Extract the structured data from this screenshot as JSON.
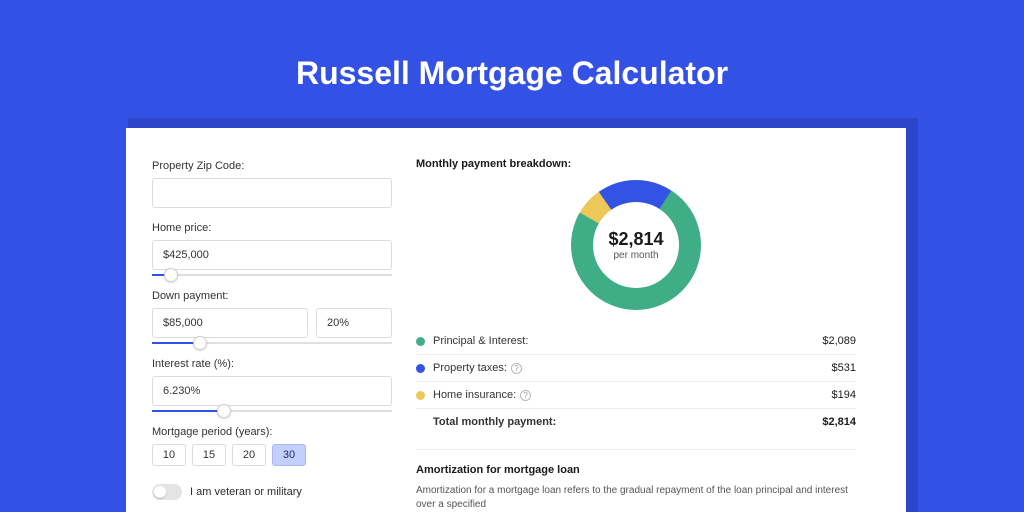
{
  "header": {
    "title": "Russell Mortgage Calculator"
  },
  "form": {
    "zip": {
      "label": "Property Zip Code:",
      "value": "",
      "placeholder": ""
    },
    "home_price": {
      "label": "Home price:",
      "value": "$425,000",
      "slider_pct": 8
    },
    "down_payment": {
      "label": "Down payment:",
      "amount": "$85,000",
      "percent": "20%",
      "slider_pct": 20
    },
    "interest_rate": {
      "label": "Interest rate (%):",
      "value": "6.230%",
      "slider_pct": 30
    },
    "mortgage_period": {
      "label": "Mortgage period (years):",
      "options": [
        "10",
        "15",
        "20",
        "30"
      ],
      "selected": "30"
    },
    "veteran": {
      "label": "I am veteran or military",
      "on": false
    }
  },
  "breakdown": {
    "title": "Monthly payment breakdown:",
    "center_amount": "$2,814",
    "center_sub": "per month",
    "items": [
      {
        "label": "Principal & Interest:",
        "value": "$2,089",
        "color": "#3fae87",
        "info": false
      },
      {
        "label": "Property taxes:",
        "value": "$531",
        "color": "#3353e4",
        "info": true
      },
      {
        "label": "Home insurance:",
        "value": "$194",
        "color": "#ebc857",
        "info": true
      }
    ],
    "total": {
      "label": "Total monthly payment:",
      "value": "$2,814"
    }
  },
  "amortization": {
    "title": "Amortization for mortgage loan",
    "text": "Amortization for a mortgage loan refers to the gradual repayment of the loan principal and interest over a specified"
  },
  "chart_data": {
    "type": "pie",
    "title": "Monthly payment breakdown",
    "categories": [
      "Principal & Interest",
      "Property taxes",
      "Home insurance"
    ],
    "values": [
      2089,
      531,
      194
    ],
    "colors": [
      "#3fae87",
      "#3353e4",
      "#ebc857"
    ],
    "total_label": "$2,814 per month"
  }
}
